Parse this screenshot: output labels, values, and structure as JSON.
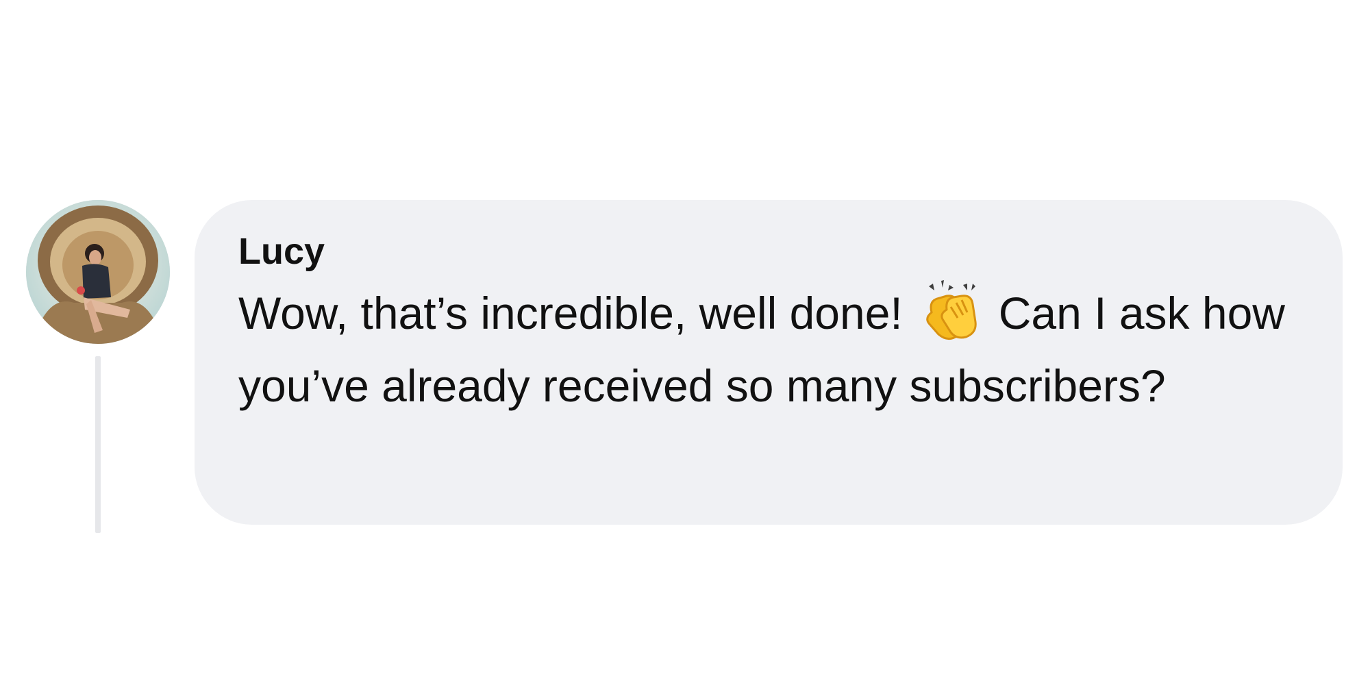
{
  "comment": {
    "author": "Lucy",
    "message_before_emoji": "Wow, that’s incredible, well done!",
    "emoji": "clapping-hands-icon",
    "message_after_emoji": "Can I ask how you’ve already received so many subscribers?"
  },
  "colors": {
    "bubble_background": "#f0f1f4",
    "thread_line": "#e6e7ea",
    "text": "#111111",
    "emoji": "#f5b91e"
  }
}
